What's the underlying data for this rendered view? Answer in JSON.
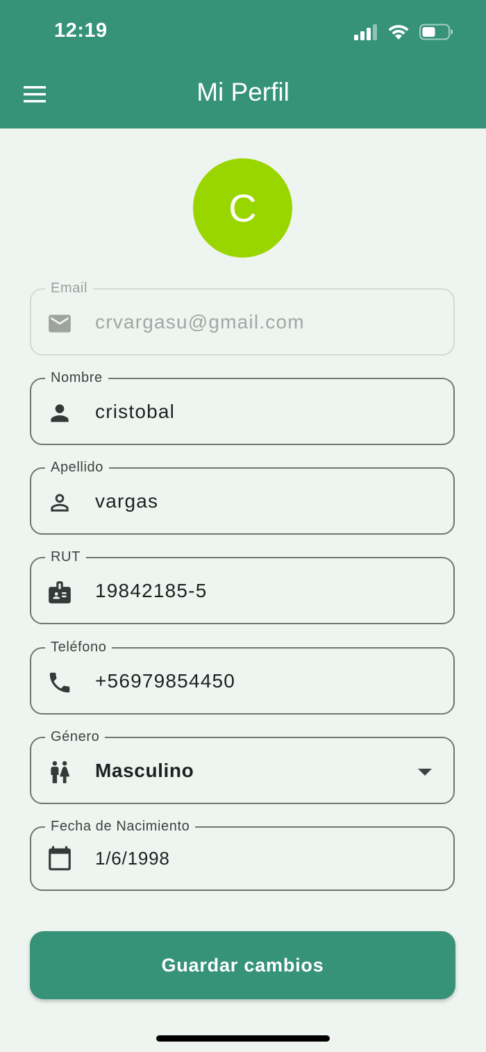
{
  "status_bar": {
    "time": "12:19",
    "icons": [
      "signal-icon",
      "wifi-icon",
      "battery-icon"
    ]
  },
  "header": {
    "title": "Mi Perfil",
    "menu_icon": "menu-icon",
    "background": "#369378"
  },
  "avatar": {
    "initial": "C",
    "color": "#99d600"
  },
  "form": {
    "email": {
      "label": "Email",
      "value": "crvargasu@gmail.com",
      "icon": "mail-icon",
      "disabled": true
    },
    "nombre": {
      "label": "Nombre",
      "value": "cristobal",
      "icon": "person-icon"
    },
    "apellido": {
      "label": "Apellido",
      "value": "vargas",
      "icon": "person-outline-icon"
    },
    "rut": {
      "label": "RUT",
      "value": "19842185-5",
      "icon": "badge-icon"
    },
    "telefono": {
      "label": "Teléfono",
      "value": "+56979854450",
      "icon": "phone-icon"
    },
    "genero": {
      "label": "Género",
      "value": "Masculino",
      "icon": "wc-icon"
    },
    "fecha": {
      "label": "Fecha de Nacimiento",
      "value": "1/6/1998",
      "icon": "calendar-icon"
    }
  },
  "actions": {
    "save_label": "Guardar cambios"
  }
}
